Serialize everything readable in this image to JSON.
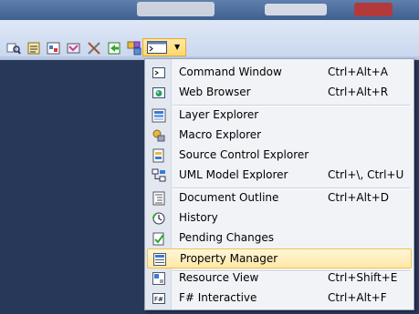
{
  "toolbar": {
    "buttons": [
      {
        "icon": "find-icon"
      },
      {
        "icon": "properties-icon"
      },
      {
        "icon": "object-browser-icon"
      },
      {
        "icon": "toolbox-icon"
      },
      {
        "icon": "tools-icon"
      },
      {
        "icon": "start-page-icon"
      },
      {
        "icon": "class-view-icon"
      }
    ],
    "dropdown_icon": "command-window-icon"
  },
  "menu": {
    "items": [
      {
        "label": "Command Window",
        "shortcut": "Ctrl+Alt+A",
        "icon": "command-window-icon"
      },
      {
        "label": "Web Browser",
        "shortcut": "Ctrl+Alt+R",
        "icon": "web-browser-icon"
      },
      {
        "label": "Layer Explorer",
        "shortcut": "",
        "icon": "layer-explorer-icon"
      },
      {
        "label": "Macro Explorer",
        "shortcut": "",
        "icon": "macro-explorer-icon"
      },
      {
        "label": "Source Control Explorer",
        "shortcut": "",
        "icon": "source-control-icon"
      },
      {
        "label": "UML Model Explorer",
        "shortcut": "Ctrl+\\, Ctrl+U",
        "icon": "uml-explorer-icon"
      },
      {
        "label": "Document Outline",
        "shortcut": "Ctrl+Alt+D",
        "icon": "document-outline-icon"
      },
      {
        "label": "History",
        "shortcut": "",
        "icon": "history-icon"
      },
      {
        "label": "Pending Changes",
        "shortcut": "",
        "icon": "pending-changes-icon"
      },
      {
        "label": "Property Manager",
        "shortcut": "",
        "icon": "property-manager-icon"
      },
      {
        "label": "Resource View",
        "shortcut": "Ctrl+Shift+E",
        "icon": "resource-view-icon"
      },
      {
        "label": "F# Interactive",
        "shortcut": "Ctrl+Alt+F",
        "icon": "fsharp-interactive-icon"
      }
    ],
    "highlighted_index": 9
  },
  "colors": {
    "highlight_bg": "#ffe8a6",
    "highlight_border": "#f0c251",
    "menu_bg": "#f1f3f7",
    "workspace_bg": "#29395b"
  }
}
